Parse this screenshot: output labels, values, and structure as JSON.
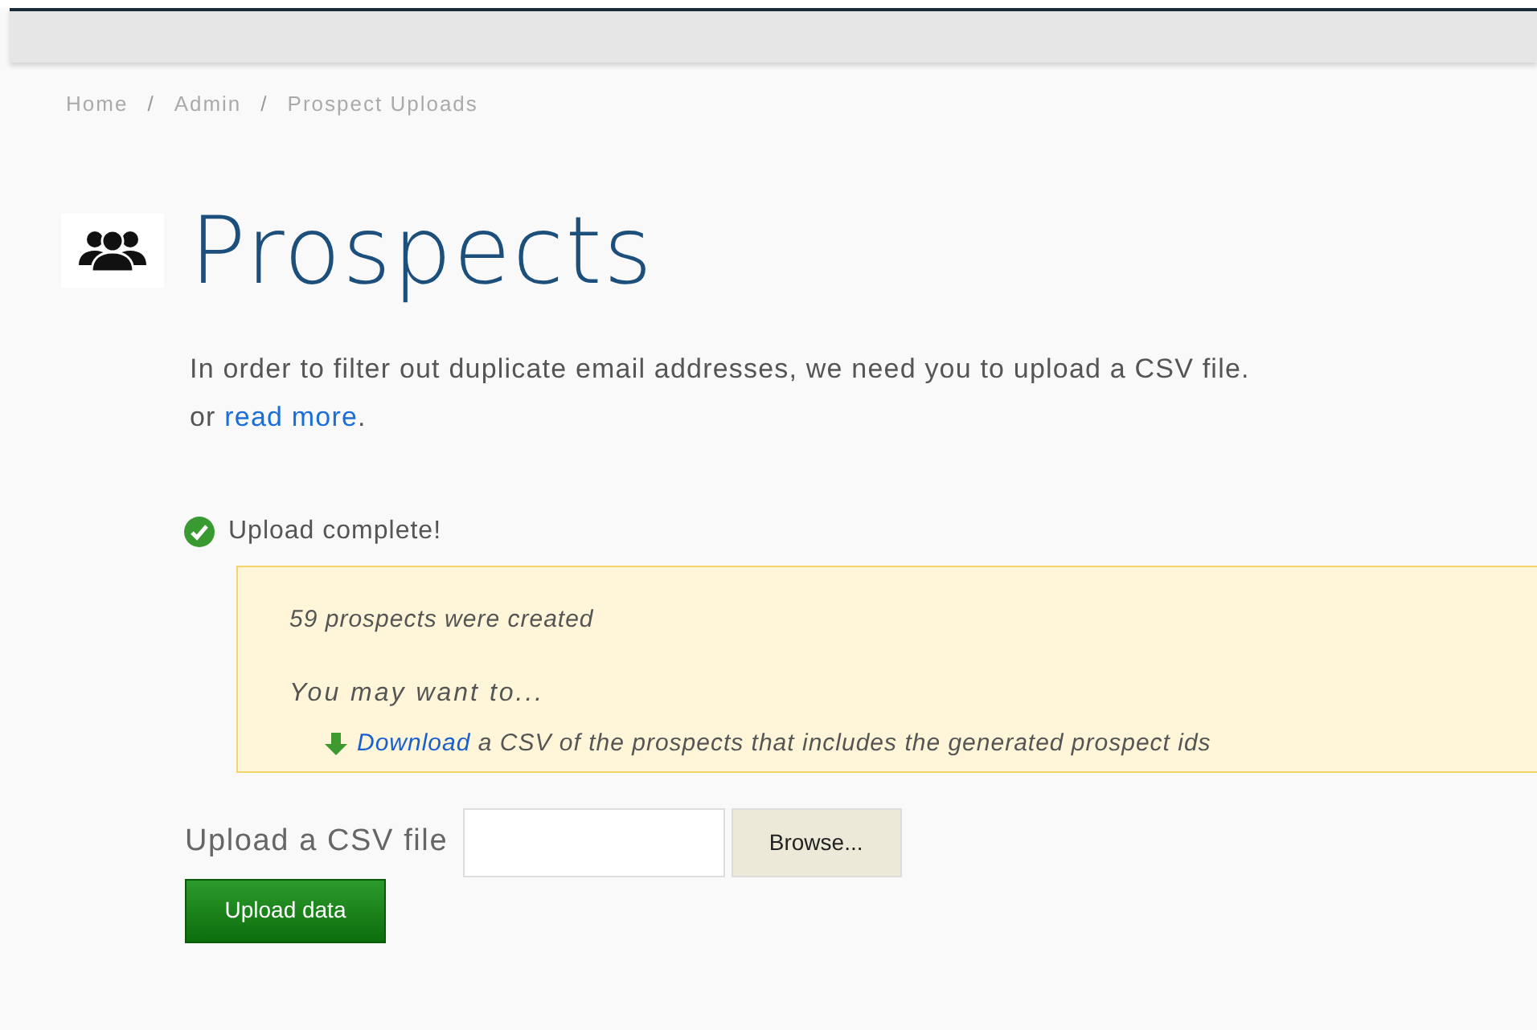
{
  "breadcrumb": {
    "separator": "/",
    "items": [
      "Home",
      "Admin",
      "Prospect Uploads"
    ]
  },
  "page_title": "Prospects",
  "intro": {
    "line_1": "In order to filter out duplicate email addresses, we need you to upload a CSV file.",
    "line_2_prefix": "or",
    "link": "read more",
    "line_2_suffix": "."
  },
  "status": {
    "kind": "success",
    "message": "Upload complete!"
  },
  "result_box": {
    "summary": "59 prospects were created",
    "prompt": "You may want to...",
    "action_link": "Download",
    "action_text": "a CSV of the prospects that includes the generated prospect ids"
  },
  "upload_form": {
    "label": "Upload a CSV file",
    "browse_button": "Browse...",
    "submit_button": "Upload data"
  }
}
